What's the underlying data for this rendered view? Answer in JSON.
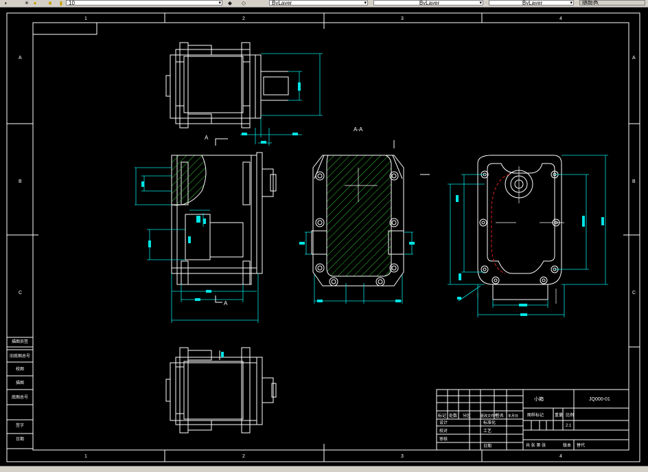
{
  "toolbar": {
    "layer_value": "10",
    "color_value": "ByLayer",
    "linetype_value": "ByLayer",
    "lineweight_value": "ByLayer",
    "plotstyle_value": "随颜色"
  },
  "frame": {
    "col_labels_top": [
      "1",
      "2",
      "3",
      "4"
    ],
    "col_labels_bottom": [
      "1",
      "2",
      "3",
      "4"
    ],
    "row_labels_left": [
      "A",
      "B",
      "C"
    ],
    "row_labels_right": [
      "A",
      "B",
      "C"
    ]
  },
  "views": {
    "section_marker_left": "A",
    "section_marker_bottom": "A",
    "section_title": "A-A"
  },
  "side_table": {
    "rows": [
      "描图员签",
      "旧底图总号",
      "校图",
      "描图",
      "底图总号",
      "签字",
      "日期"
    ]
  },
  "title_block": {
    "part_name": "小箱",
    "drawing_no": "JQ000-01",
    "material_label": "图样标记",
    "weight_label": "重量",
    "scale_label": "比例",
    "scale_value": "2:1",
    "sheet_count_label": "共 张  第 张",
    "version_label": "版本",
    "replace_label": "替代",
    "designer_label": "设计",
    "checker_label": "校对",
    "process_label": "工艺",
    "standard_label": "标准化",
    "approve_label": "审核",
    "date_label": "日期",
    "mark_label": "标记",
    "count_label": "处数",
    "zone_label": "分区",
    "change_doc_label": "更改文件号",
    "sign_label": "签名",
    "year_label": "年月日"
  }
}
